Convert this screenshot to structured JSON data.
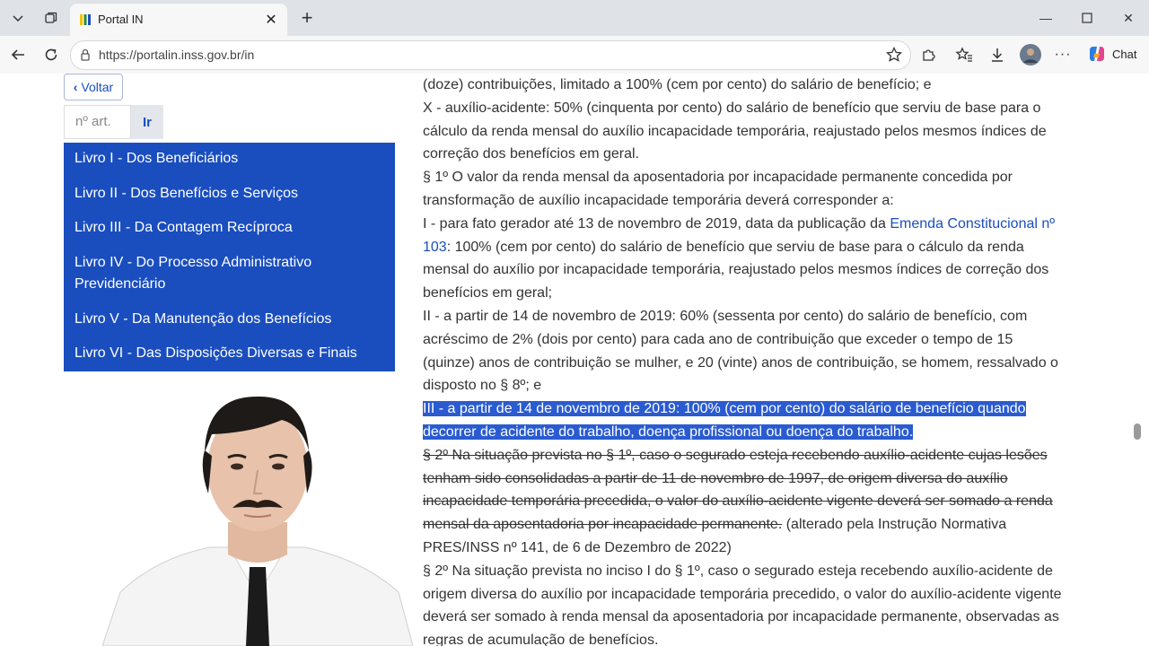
{
  "browser": {
    "tab_title": "Portal IN",
    "url": "https://portalin.inss.gov.br/in",
    "chat_label": "Chat"
  },
  "sidebar": {
    "back_label": "Voltar",
    "article_placeholder": "nº art.",
    "go_label": "Ir",
    "books": [
      "Livro I - Dos Beneficiários",
      "Livro II - Dos Benefícios e Serviços",
      "Livro III - Da Contagem Recíproca",
      "Livro IV - Do Processo Administrativo Previdenciário",
      "Livro V - Da Manutenção dos Benefícios",
      "Livro VI - Das Disposições Diversas e Finais"
    ]
  },
  "content": {
    "p1": "(doze) contribuições, limitado a 100% (cem por cento) do salário de benefício; e",
    "p2": "X - auxílio-acidente: 50% (cinquenta por cento) do salário de benefício que serviu de base para o cálculo da renda mensal do auxílio incapacidade temporária, reajustado pelos mesmos índices de correção dos benefícios em geral.",
    "p3": "§ 1º O valor da renda mensal da aposentadoria por incapacidade permanente concedida por transformação de auxílio incapacidade temporária deverá corresponder a:",
    "p4_pre": "I - para fato gerador até 13 de novembro de 2019, data da publicação da ",
    "p4_link": "Emenda Constitucional nº 103",
    "p4_post": ": 100% (cem por cento) do salário de benefício que serviu de base para o cálculo da renda mensal do auxílio por incapacidade temporária, reajustado pelos mesmos índices de correção dos benefícios em geral;",
    "p5": "II - a partir de 14 de novembro de 2019: 60% (sessenta por cento) do salário de benefício, com acréscimo de 2% (dois por cento) para cada ano de contribuição que exceder o tempo de 15 (quinze) anos de contribuição se mulher, e 20 (vinte) anos de contribuição, se homem, ressalvado o disposto no § 8º; e",
    "p6": "III - a partir de 14 de novembro de 2019: 100% (cem por cento) do salário de benefício quando decorrer de acidente do trabalho, doença profissional ou doença do trabalho.",
    "p7_struck": "§ 2º Na situação prevista no § 1º, caso o segurado esteja recebendo auxílio-acidente cujas lesões tenham sido consolidadas a partir de 11 de novembro de 1997, de origem diversa do auxílio incapacidade temporária precedida, o valor do auxílio-acidente vigente deverá ser somado a renda mensal da aposentadoria por incapacidade permanente.",
    "p7_note": " (alterado pela Instrução Normativa PRES/INSS nº 141, de 6 de Dezembro de 2022)",
    "p8": "§ 2º Na situação prevista no inciso I do § 1º, caso o segurado esteja recebendo auxílio-acidente de origem diversa do auxílio por incapacidade temporária precedido, o valor do auxílio-acidente vigente deverá ser somado à renda mensal da aposentadoria por incapacidade permanente, observadas as regras de acumulação de benefícios."
  }
}
